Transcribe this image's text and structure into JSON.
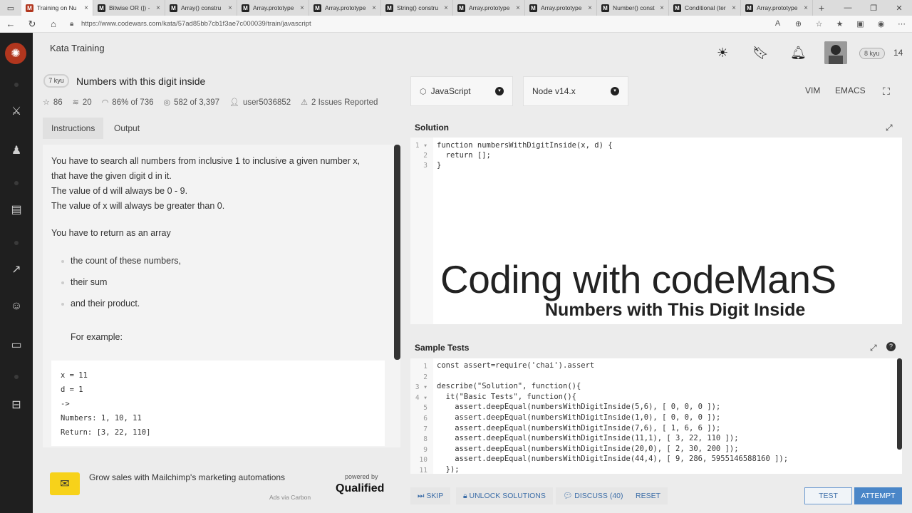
{
  "browser": {
    "tabs": [
      {
        "title": "Training on Nu",
        "active": true
      },
      {
        "title": "Bitwise OR (|) -"
      },
      {
        "title": "Array() constru"
      },
      {
        "title": "Array.prototype"
      },
      {
        "title": "Array.prototype"
      },
      {
        "title": "String() constru"
      },
      {
        "title": "Array.prototype"
      },
      {
        "title": "Array.prototype"
      },
      {
        "title": "Number() const"
      },
      {
        "title": "Conditional (ter"
      },
      {
        "title": "Array.prototype"
      }
    ],
    "url": "https://www.codewars.com/kata/57ad85bb7cb1f3ae7c000039/train/javascript"
  },
  "header": {
    "section_title": "Kata Training",
    "rank": "8 kyu",
    "honor": "14"
  },
  "kata": {
    "kyu": "7 kyu",
    "title": "Numbers with this digit inside",
    "stars": "86",
    "collections": "20",
    "satisfaction": "86% of 736",
    "completed": "582 of 3,397",
    "author": "user5036852",
    "issues": "2 Issues Reported"
  },
  "tabs": {
    "instructions": "Instructions",
    "output": "Output"
  },
  "instructions": {
    "p1a": "You have to search all numbers from inclusive 1 to inclusive a given number x,",
    "p1b": "that have the given digit d in it.",
    "p1c": "The value of d will always be 0 - 9.",
    "p1d": "The value of x will always be greater than 0.",
    "p2": "You have to return as an array",
    "bullets": [
      "the count of these numbers,",
      "their sum",
      "and their product."
    ],
    "example_label": "For example:",
    "code": [
      "x = 11",
      "d = 1",
      "->",
      "Numbers: 1, 10, 11",
      "Return: [3, 22, 110]"
    ]
  },
  "ad": {
    "text": "Grow sales with Mailchimp's marketing automations",
    "via": "Ads via Carbon",
    "powered_by": "powered by",
    "brand": "Qualified"
  },
  "editor": {
    "language": "JavaScript",
    "runtime": "Node v14.x",
    "mode_vim": "VIM",
    "mode_emacs": "EMACS",
    "solution_label": "Solution",
    "tests_label": "Sample Tests",
    "watermark_line1": "Coding with codeManS",
    "watermark_line2": "Numbers with This Digit Inside",
    "solution_lines": [
      "function numbersWithDigitInside(x, d) {",
      "  return [];",
      "}"
    ],
    "test_lines": [
      "const assert=require('chai').assert",
      "",
      "describe(\"Solution\", function(){",
      "  it(\"Basic Tests\", function(){",
      "    assert.deepEqual(numbersWithDigitInside(5,6), [ 0, 0, 0 ]);",
      "    assert.deepEqual(numbersWithDigitInside(1,0), [ 0, 0, 0 ]);",
      "    assert.deepEqual(numbersWithDigitInside(7,6), [ 1, 6, 6 ]);",
      "    assert.deepEqual(numbersWithDigitInside(11,1), [ 3, 22, 110 ]);",
      "    assert.deepEqual(numbersWithDigitInside(20,0), [ 2, 30, 200 ]);",
      "    assert.deepEqual(numbersWithDigitInside(44,4), [ 9, 286, 5955146588160 ]);",
      "  });"
    ]
  },
  "actions": {
    "skip": "SKIP",
    "unlock": "UNLOCK SOLUTIONS",
    "discuss": "DISCUSS (40)",
    "reset": "RESET",
    "test": "TEST",
    "attempt": "ATTEMPT"
  },
  "colors": {
    "brand": "#b1361e",
    "sidebar": "#1f1f1f",
    "action_blue": "#4a86c8"
  }
}
